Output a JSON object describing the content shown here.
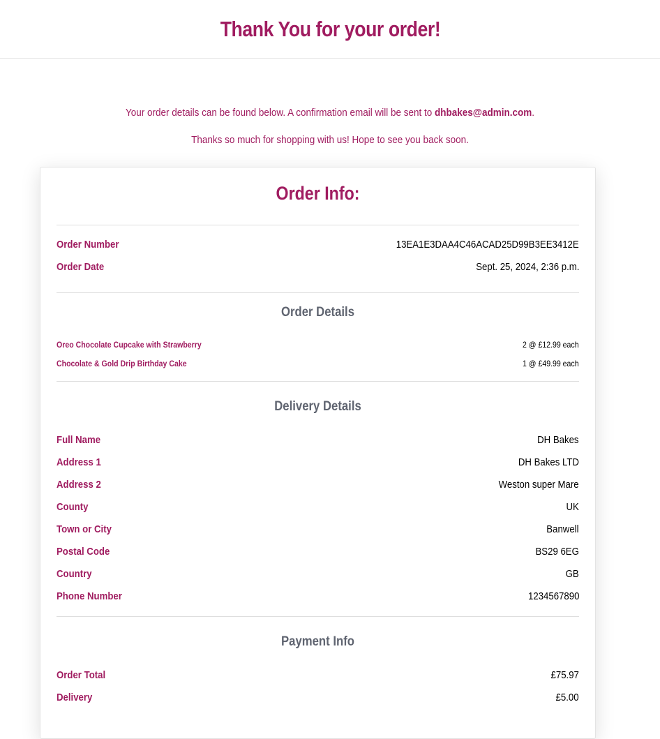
{
  "header": {
    "title": "Thank You for your order!"
  },
  "intro": {
    "line1_prefix": "Your order details can be found below. A confirmation email will be sent to ",
    "email": "dhbakes@admin.com",
    "line1_suffix": ".",
    "line2": "Thanks so much for shopping with us! Hope to see you back soon."
  },
  "order_info": {
    "title": "Order Info:",
    "order_number_label": "Order Number",
    "order_number": "13EA1E3DAA4C46ACAD25D99B3EE3412E",
    "order_date_label": "Order Date",
    "order_date": "Sept. 25, 2024, 2:36 p.m."
  },
  "order_details": {
    "title": "Order Details",
    "items": [
      {
        "name": "Oreo Chocolate Cupcake with Strawberry",
        "qty_price": "2 @ £12.99 each"
      },
      {
        "name": "Chocolate & Gold Drip Birthday Cake",
        "qty_price": "1 @ £49.99 each"
      }
    ]
  },
  "delivery": {
    "title": "Delivery Details",
    "fields": [
      {
        "label": "Full Name",
        "value": "DH Bakes"
      },
      {
        "label": "Address 1",
        "value": "DH Bakes LTD"
      },
      {
        "label": "Address 2",
        "value": "Weston super Mare"
      },
      {
        "label": "County",
        "value": "UK"
      },
      {
        "label": "Town or City",
        "value": "Banwell"
      },
      {
        "label": "Postal Code",
        "value": "BS29 6EG"
      },
      {
        "label": "Country",
        "value": "GB"
      },
      {
        "label": "Phone Number",
        "value": "1234567890"
      }
    ]
  },
  "payment": {
    "title": "Payment Info",
    "fields": [
      {
        "label": "Order Total",
        "value": "£75.97"
      },
      {
        "label": "Delivery",
        "value": "£5.00"
      }
    ]
  },
  "colors": {
    "brand": "#a01c60",
    "section_heading": "#5f6470"
  }
}
